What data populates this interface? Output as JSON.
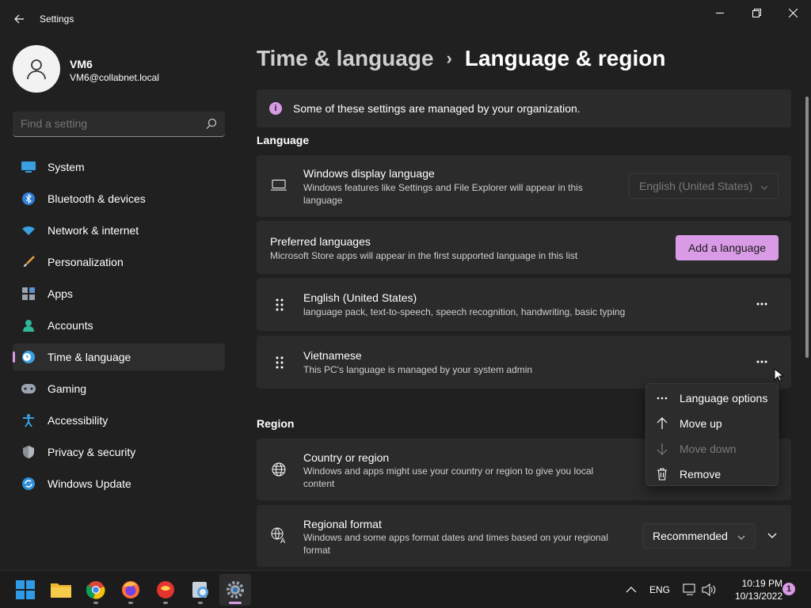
{
  "window": {
    "title": "Settings",
    "controls": [
      "minimize",
      "maximize",
      "close"
    ]
  },
  "profile": {
    "name": "VM6",
    "email": "VM6@collabnet.local"
  },
  "search": {
    "placeholder": "Find a setting"
  },
  "sidebar": {
    "items": [
      {
        "label": "System",
        "icon": "system-icon"
      },
      {
        "label": "Bluetooth & devices",
        "icon": "bluetooth-icon"
      },
      {
        "label": "Network & internet",
        "icon": "wifi-icon"
      },
      {
        "label": "Personalization",
        "icon": "brush-icon"
      },
      {
        "label": "Apps",
        "icon": "apps-icon"
      },
      {
        "label": "Accounts",
        "icon": "accounts-icon"
      },
      {
        "label": "Time & language",
        "icon": "time-language-icon",
        "active": true
      },
      {
        "label": "Gaming",
        "icon": "gamepad-icon"
      },
      {
        "label": "Accessibility",
        "icon": "accessibility-icon"
      },
      {
        "label": "Privacy & security",
        "icon": "shield-icon"
      },
      {
        "label": "Windows Update",
        "icon": "update-icon"
      }
    ]
  },
  "breadcrumb": {
    "parent": "Time & language",
    "separator": "›",
    "current": "Language & region"
  },
  "notice": {
    "text": "Some of these settings are managed by your organization."
  },
  "language_section": {
    "title": "Language",
    "display_language": {
      "title": "Windows display language",
      "subtitle": "Windows features like Settings and File Explorer will appear in this language",
      "value": "English (United States)"
    },
    "preferred": {
      "title": "Preferred languages",
      "subtitle": "Microsoft Store apps will appear in the first supported language in this list",
      "add_button": "Add a language"
    },
    "languages": [
      {
        "name": "English (United States)",
        "detail": "language pack, text-to-speech, speech recognition, handwriting, basic typing"
      },
      {
        "name": "Vietnamese",
        "detail": "This PC's language is managed by your system admin"
      }
    ]
  },
  "context_menu": {
    "items": [
      {
        "label": "Language options",
        "icon": "more-icon",
        "disabled": false
      },
      {
        "label": "Move up",
        "icon": "arrow-up-icon",
        "disabled": false
      },
      {
        "label": "Move down",
        "icon": "arrow-down-icon",
        "disabled": true
      },
      {
        "label": "Remove",
        "icon": "trash-icon",
        "disabled": false
      }
    ]
  },
  "region_section": {
    "title": "Region",
    "country": {
      "title": "Country or region",
      "subtitle": "Windows and apps might use your country or region to give you local content"
    },
    "format": {
      "title": "Regional format",
      "subtitle": "Windows and some apps format dates and times based on your regional format",
      "value": "Recommended"
    }
  },
  "taskbar": {
    "apps": [
      "start-icon",
      "file-explorer-icon",
      "chrome-icon",
      "firefox-icon",
      "app-icon",
      "app-icon-2",
      "settings-icon"
    ],
    "tray_lang": "ENG",
    "time": "10:19 PM",
    "date": "10/13/2022",
    "notification_count": "1"
  },
  "colors": {
    "accent": "#d99be6",
    "background": "#202020",
    "card": "#2b2b2b"
  }
}
